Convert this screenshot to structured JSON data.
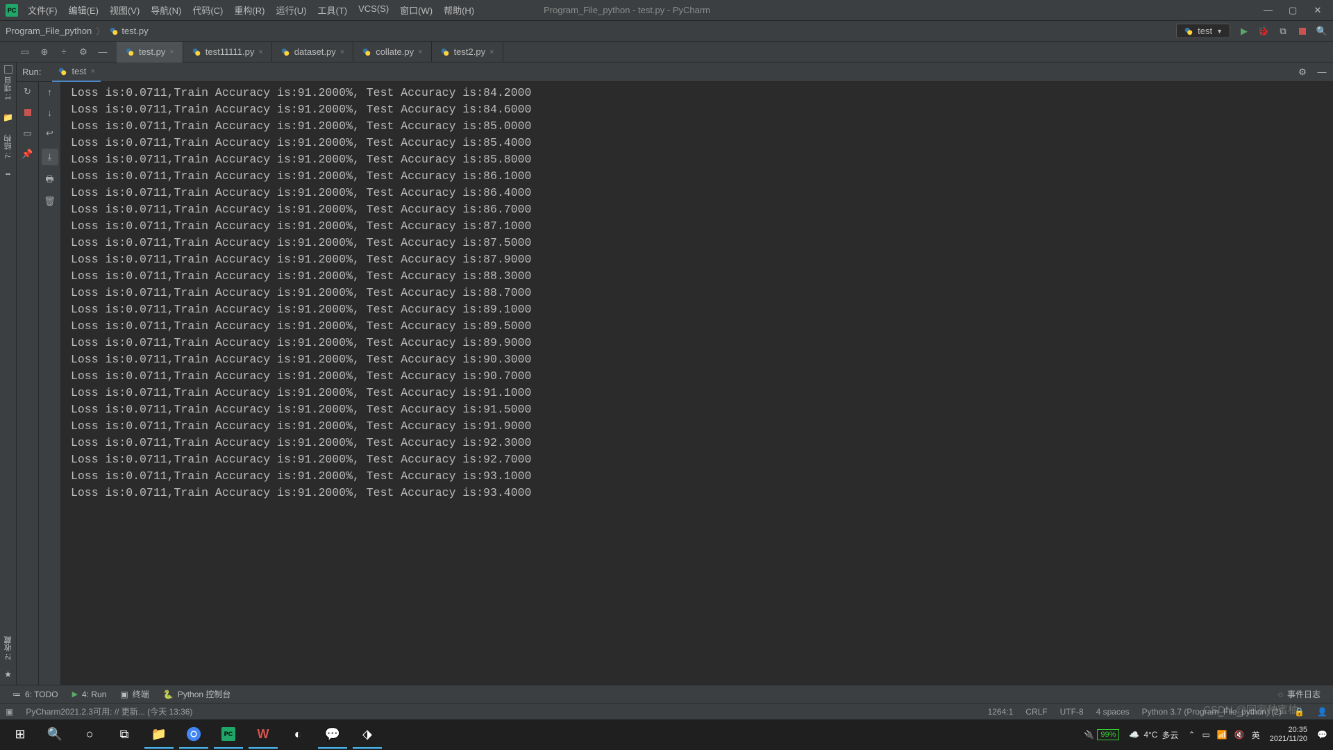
{
  "title": "Program_File_python - test.py - PyCharm",
  "menu": [
    "文件(F)",
    "编辑(E)",
    "视图(V)",
    "导航(N)",
    "代码(C)",
    "重构(R)",
    "运行(U)",
    "工具(T)",
    "VCS(S)",
    "窗口(W)",
    "帮助(H)"
  ],
  "breadcrumb": {
    "project": "Program_File_python",
    "file": "test.py"
  },
  "run_config": {
    "name": "test"
  },
  "tabs": [
    {
      "label": "test.py",
      "active": true
    },
    {
      "label": "test11111.py",
      "active": false
    },
    {
      "label": "dataset.py",
      "active": false
    },
    {
      "label": "collate.py",
      "active": false
    },
    {
      "label": "test2.py",
      "active": false
    }
  ],
  "run_panel": {
    "label": "Run:",
    "tab_name": "test"
  },
  "left_rail": {
    "project": "1: 项目",
    "structure": "7: 结构",
    "favorites": "2: 收藏"
  },
  "console_lines": [
    "Loss is:0.0711,Train Accuracy is:91.2000%, Test Accuracy is:84.2000",
    "Loss is:0.0711,Train Accuracy is:91.2000%, Test Accuracy is:84.6000",
    "Loss is:0.0711,Train Accuracy is:91.2000%, Test Accuracy is:85.0000",
    "Loss is:0.0711,Train Accuracy is:91.2000%, Test Accuracy is:85.4000",
    "Loss is:0.0711,Train Accuracy is:91.2000%, Test Accuracy is:85.8000",
    "Loss is:0.0711,Train Accuracy is:91.2000%, Test Accuracy is:86.1000",
    "Loss is:0.0711,Train Accuracy is:91.2000%, Test Accuracy is:86.4000",
    "Loss is:0.0711,Train Accuracy is:91.2000%, Test Accuracy is:86.7000",
    "Loss is:0.0711,Train Accuracy is:91.2000%, Test Accuracy is:87.1000",
    "Loss is:0.0711,Train Accuracy is:91.2000%, Test Accuracy is:87.5000",
    "Loss is:0.0711,Train Accuracy is:91.2000%, Test Accuracy is:87.9000",
    "Loss is:0.0711,Train Accuracy is:91.2000%, Test Accuracy is:88.3000",
    "Loss is:0.0711,Train Accuracy is:91.2000%, Test Accuracy is:88.7000",
    "Loss is:0.0711,Train Accuracy is:91.2000%, Test Accuracy is:89.1000",
    "Loss is:0.0711,Train Accuracy is:91.2000%, Test Accuracy is:89.5000",
    "Loss is:0.0711,Train Accuracy is:91.2000%, Test Accuracy is:89.9000",
    "Loss is:0.0711,Train Accuracy is:91.2000%, Test Accuracy is:90.3000",
    "Loss is:0.0711,Train Accuracy is:91.2000%, Test Accuracy is:90.7000",
    "Loss is:0.0711,Train Accuracy is:91.2000%, Test Accuracy is:91.1000",
    "Loss is:0.0711,Train Accuracy is:91.2000%, Test Accuracy is:91.5000",
    "Loss is:0.0711,Train Accuracy is:91.2000%, Test Accuracy is:91.9000",
    "Loss is:0.0711,Train Accuracy is:91.2000%, Test Accuracy is:92.3000",
    "Loss is:0.0711,Train Accuracy is:91.2000%, Test Accuracy is:92.7000",
    "Loss is:0.0711,Train Accuracy is:91.2000%, Test Accuracy is:93.1000",
    "Loss is:0.0711,Train Accuracy is:91.2000%, Test Accuracy is:93.4000"
  ],
  "bottom_tabs": {
    "todo": "6: TODO",
    "run": "4: Run",
    "terminal": "终端",
    "python_console": "Python 控制台",
    "event_log": "事件日志"
  },
  "status": {
    "update": "PyCharm2021.2.3可用: // 更新... (今天 13:36)",
    "pos": "1264:1",
    "eol": "CRLF",
    "encoding": "UTF-8",
    "indent": "4 spaces",
    "interpreter": "Python 3.7 (Program_File_python) (2)"
  },
  "taskbar": {
    "battery": "99%",
    "temp": "4°C",
    "weather": "多云",
    "ime": "英",
    "time": "20:35",
    "date": "2021/11/20"
  },
  "watermark": "CSDN @回家种蜜柚"
}
